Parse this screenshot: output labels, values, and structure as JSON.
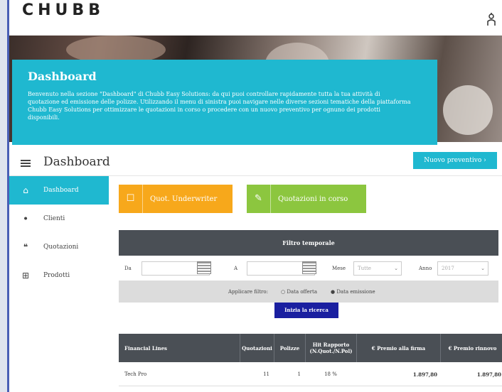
{
  "brand": {
    "logo_text": "CHUBB"
  },
  "hero": {
    "title": "Dashboard",
    "text": "Benvenuto nella sezione \"Dashboard\" di Chubb Easy Solutions: da qui puoi controllare rapidamente tutta la tua attività di quotazione ed emissione delle polizze. Utilizzando il menu di sinistra puoi navigare nelle diverse sezioni tematiche della piattaforma Chubb Easy Solutions per ottimizzare le quotazioni in corso o procedere con un nuovo preventivo per ognuno dei prodotti disponibili."
  },
  "header": {
    "page_title": "Dashboard",
    "new_button": "Nuovo preventivo"
  },
  "sidebar": {
    "items": [
      {
        "label": "Dashboard",
        "icon": "home-icon",
        "glyph": "⌂"
      },
      {
        "label": "Clienti",
        "icon": "users-icon",
        "glyph": "ꔷ"
      },
      {
        "label": "Quotazioni",
        "icon": "quote-icon",
        "glyph": "❝"
      },
      {
        "label": "Prodotti",
        "icon": "grid-icon",
        "glyph": "⊞"
      }
    ]
  },
  "tiles": {
    "orange": {
      "label": "Quot. Underwriter",
      "glyph": "☐"
    },
    "green": {
      "label": "Quotazioni in corso",
      "glyph": "✎"
    }
  },
  "filter": {
    "title": "Filtro temporale",
    "from_label": "Da",
    "to_label": "A",
    "year_label": "Mese",
    "year_placeholder": "Tutte",
    "month_label": "Anno",
    "month_placeholder": "2017",
    "apply_label": "Applicare filtro:",
    "option1": "Data offerta",
    "option2": "Data emissione",
    "tour_button": "Inizia la ricerca"
  },
  "table": {
    "headers": [
      "Financial Lines",
      "Quotazioni",
      "Polizze",
      "Hit Rapporto (N.Quot./N.Pol)",
      "€ Premio alla firma",
      "€ Premio rinnovo"
    ],
    "rows": [
      {
        "name": "Tech Pro",
        "quotazioni": "11",
        "polizze": "1",
        "hit": "18 %",
        "premio_firma": "1.897,80",
        "premio_rinnovo": "1.897,80"
      }
    ]
  }
}
